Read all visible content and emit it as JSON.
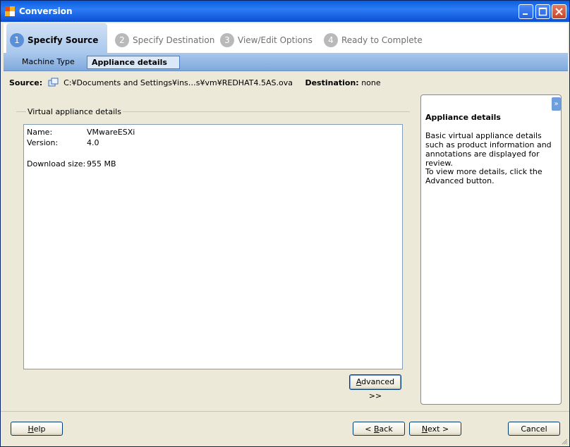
{
  "window": {
    "title": "Conversion"
  },
  "steps": [
    {
      "num": "1",
      "label": "Specify Source",
      "active": true
    },
    {
      "num": "2",
      "label": "Specify Destination"
    },
    {
      "num": "3",
      "label": "View/Edit Options"
    },
    {
      "num": "4",
      "label": "Ready to Complete"
    }
  ],
  "substeps": [
    {
      "label": "Machine Type"
    },
    {
      "label": "Appliance details",
      "selected": true
    }
  ],
  "source": {
    "label": "Source:",
    "path": "C:¥Documents and Settings¥ins…s¥vm¥REDHAT4.5AS.ova",
    "dest_label": "Destination:",
    "dest_value": "none"
  },
  "group": {
    "legend": "Virtual appliance details"
  },
  "details": {
    "name_label": "Name:",
    "name_value": "VMwareESXi",
    "version_label": "Version:",
    "version_value": "4.0",
    "size_label": "Download size:",
    "size_value": "955 MB"
  },
  "buttons": {
    "advanced_pre": "A",
    "advanced_post": "dvanced >>",
    "help_pre": "H",
    "help_post": "elp",
    "back_pre": "< ",
    "back_u": "B",
    "back_post": "ack",
    "next_u": "N",
    "next_post": "ext >",
    "cancel": "Cancel"
  },
  "help": {
    "title": "Appliance details",
    "p1": "Basic virtual appliance details such as product information and annotations are displayed for review.",
    "p2": "To view more details, click the Advanced button."
  },
  "colors": {
    "titlebar": "#0a5fe0",
    "accent": "#5b8fd8",
    "panel_bg": "#ece9d8"
  },
  "icons": {
    "app": "vmware-converter-icon",
    "source": "virtual-machine-icon",
    "help_toggle": "double-chevron-right-icon"
  }
}
